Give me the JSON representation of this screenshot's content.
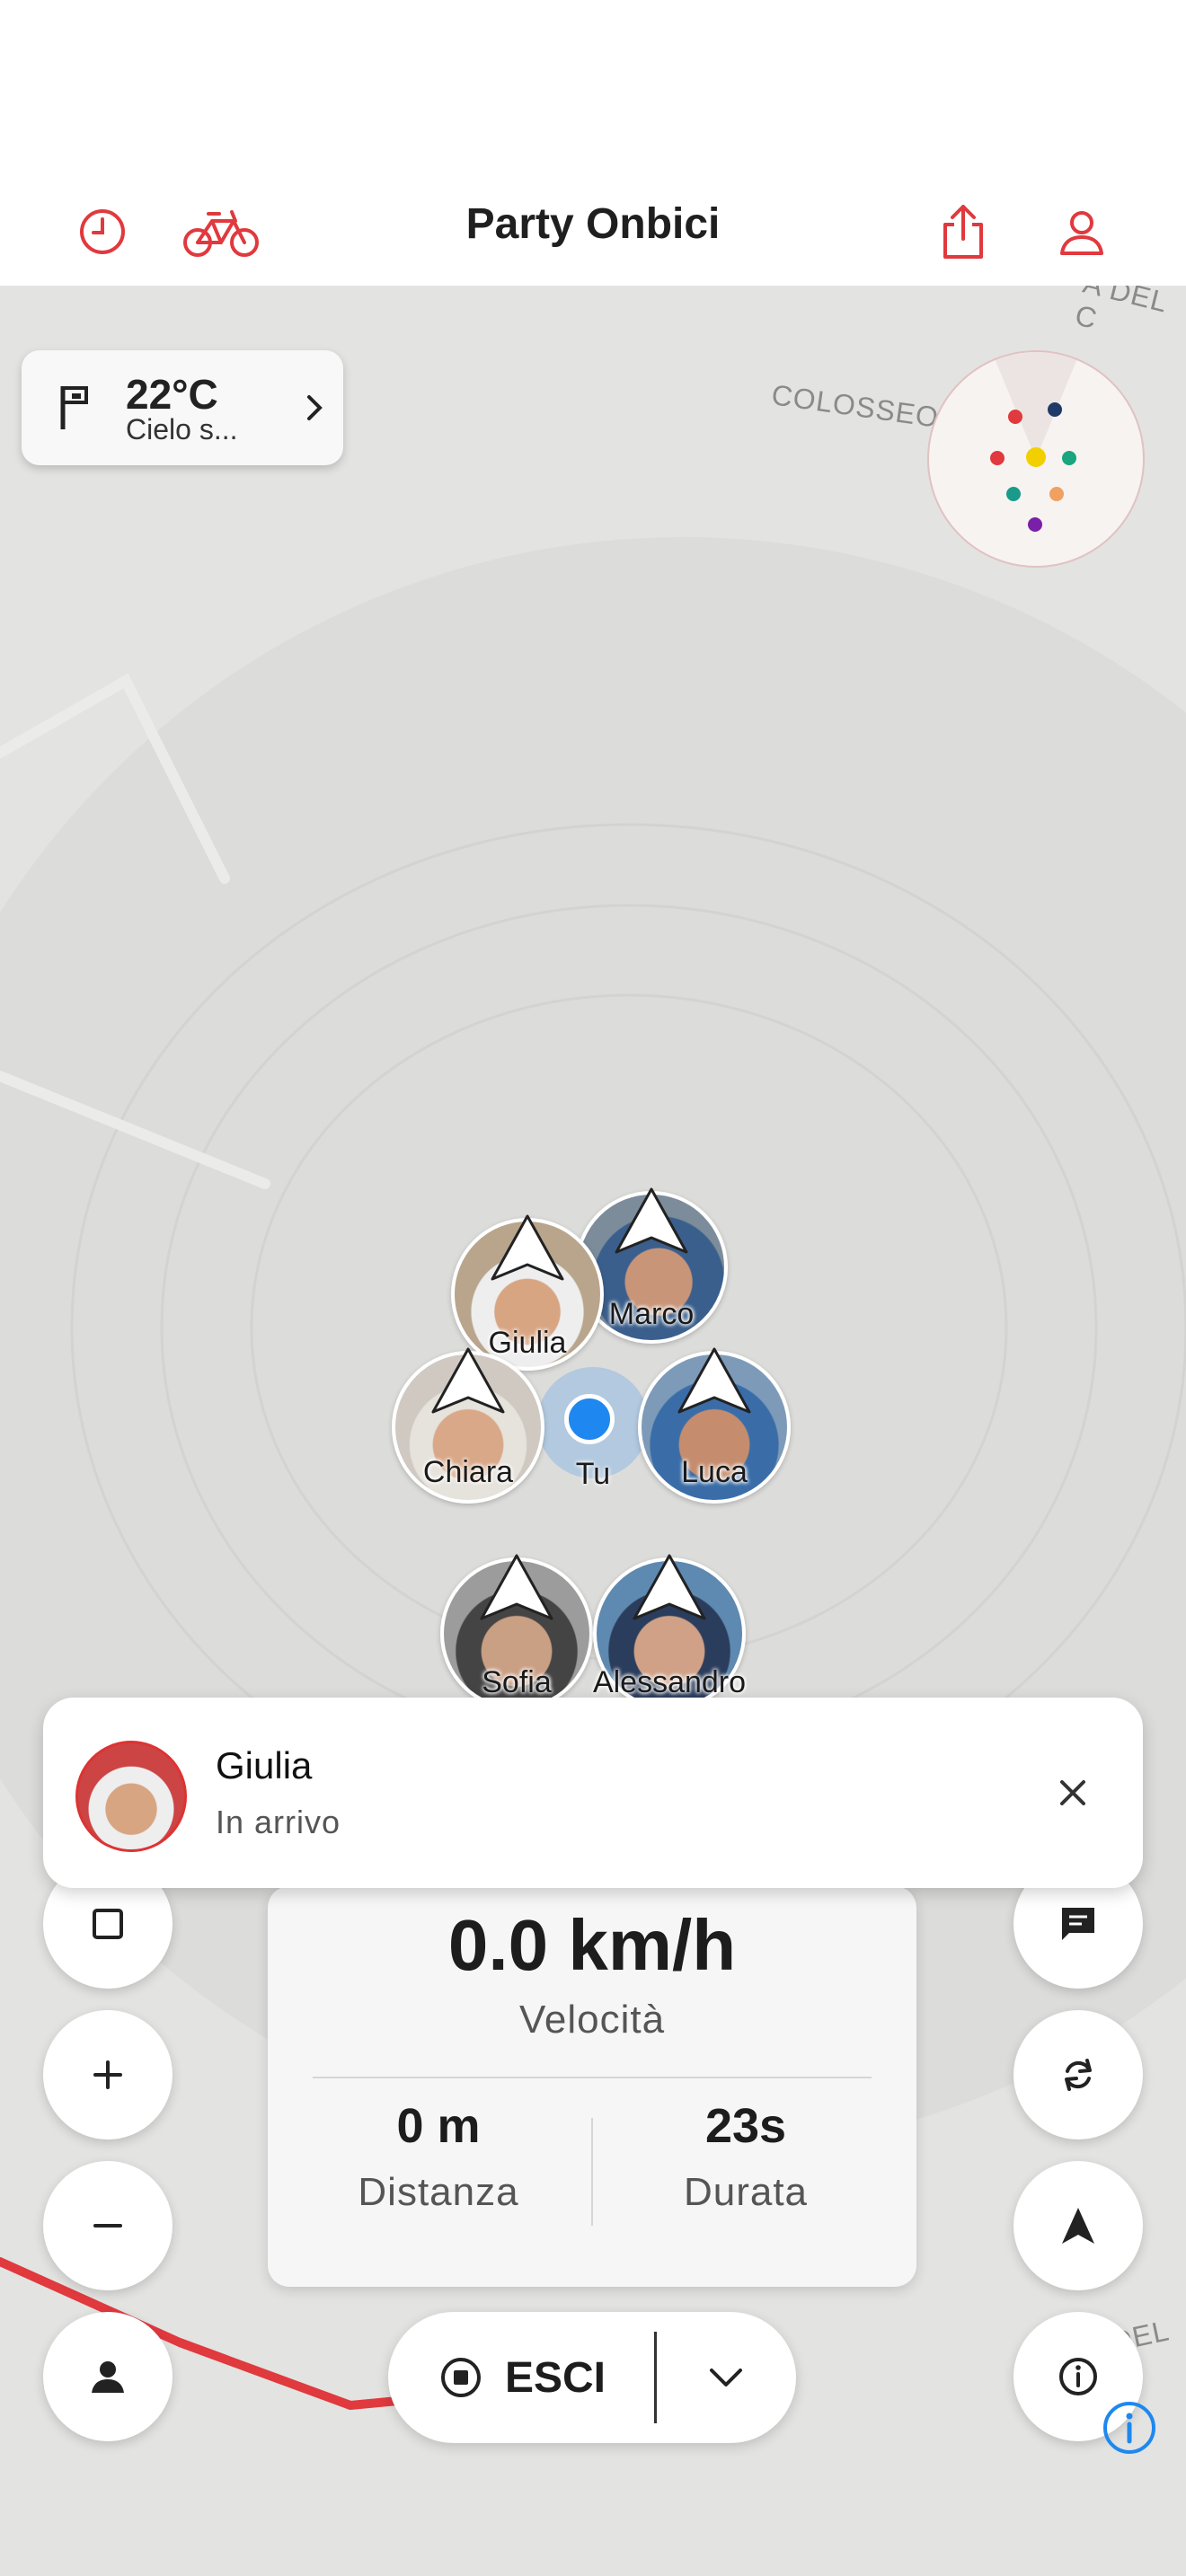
{
  "header": {
    "title": "Party Onbici",
    "icons": [
      "history-clock-icon",
      "bike-icon",
      "share-icon",
      "profile-icon"
    ],
    "accent": "#e0393e"
  },
  "weather": {
    "temperature": "22°C",
    "description": "Cielo s...",
    "icons": [
      "flag-icon",
      "chevron-right-icon"
    ]
  },
  "map": {
    "labels": [
      "COLOSSEO",
      "A DEL C",
      "ZA DEL"
    ],
    "route_color": "#e0393e",
    "background": "#e3e3e1"
  },
  "radar": {
    "dot_colors": [
      "#e0393e",
      "#1f3a66",
      "#f2d000",
      "#19a57e",
      "#e0393e",
      "#1a9a8a",
      "#f0a060",
      "#7a1fa8"
    ]
  },
  "riders": [
    {
      "name": "Marco"
    },
    {
      "name": "Giulia"
    },
    {
      "name": "Chiara"
    },
    {
      "name": "Luca"
    },
    {
      "name": "Sofia"
    },
    {
      "name": "Alessandro"
    }
  ],
  "you": {
    "label": "Tu",
    "color": "#1e88f0"
  },
  "toast": {
    "name": "Giulia",
    "status": "In arrivo"
  },
  "stats": {
    "speed": "0.0 km/h",
    "speed_label": "Velocità",
    "distance": "0 m",
    "distance_label": "Distanza",
    "duration": "23s",
    "duration_label": "Durata"
  },
  "controls": {
    "exit_label": "ESCI",
    "left_icons": [
      "layers-square-icon",
      "zoom-in-icon",
      "zoom-out-icon",
      "person-icon"
    ],
    "right_icons": [
      "chat-icon",
      "sync-icon",
      "navigate-arrow-icon",
      "info-icon"
    ]
  }
}
